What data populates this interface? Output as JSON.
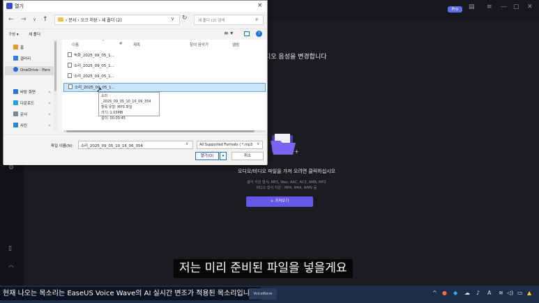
{
  "app": {
    "pro_badge": "Pro",
    "heading": "디오 음성을 변경합니다",
    "drop_main": "오디오/비디오 파일을 가져 오려면 클릭하십시오",
    "drop_sub1": "음악 지원 형식: MP3, Wav, AAC, AC3, AMR, MP2",
    "drop_sub2": "비디오 형식 지원 : MP4, M4A, WMV 등",
    "import_button": "+ 가져오기",
    "accent_color": "#6558e8"
  },
  "dialog": {
    "title": "열기",
    "close": "×",
    "breadcrumb": [
      "문서",
      "오크 저장",
      "새 폴더 (2)"
    ],
    "search_placeholder": "새 폴더 (2) 검색",
    "toolbar": {
      "organize": "구성 ▾",
      "new_folder": "새 폴더"
    },
    "nav_items": [
      {
        "label": "홈",
        "icon_color": "#e49b2f"
      },
      {
        "label": "갤러리",
        "icon_color": "#2f7fd6"
      },
      {
        "label": "OneDrive - Pers",
        "icon_color": "#1f6fd0"
      },
      {
        "label": "바탕 화면",
        "icon_color": "#2a74c9"
      },
      {
        "label": "다운로드",
        "icon_color": "#2aa0e0"
      },
      {
        "label": "문서",
        "icon_color": "#7b8794"
      },
      {
        "label": "사진",
        "icon_color": "#2a84d4"
      }
    ],
    "columns": {
      "name": "이름",
      "number": "#",
      "title": "제목",
      "artist": "참여 음악가",
      "album": "앨범"
    },
    "files": [
      "녹화_2025_09_05_1...",
      "소리_2025_09_05_1...",
      "소리_2025_09_05_1...",
      "소리_2025_09_05_1..."
    ],
    "tooltip": {
      "name": "소리_2025_09_05_10_16_06_354",
      "type": "항목 유형: MP3 파일",
      "size": "크기: 1.03MB",
      "length": "길이: 00:00:45"
    },
    "filename_label": "파일 이름(N):",
    "filename_value": "소리_2025_09_05_10_16_06_354",
    "filetype_value": "All Supported Formats ( *.mp3",
    "open_button": "열기(O)",
    "cancel_button": "취소"
  },
  "subtitle": "저는 미리 준비된 파일을 넣을게요",
  "caption": "현재 나오는 목소리는 EaseUS Voice Wave의 AI 실시간 변조가 적용된 목소리입니다.",
  "taskbar": {
    "app_chip": "VoiceWave",
    "ime": "A"
  }
}
